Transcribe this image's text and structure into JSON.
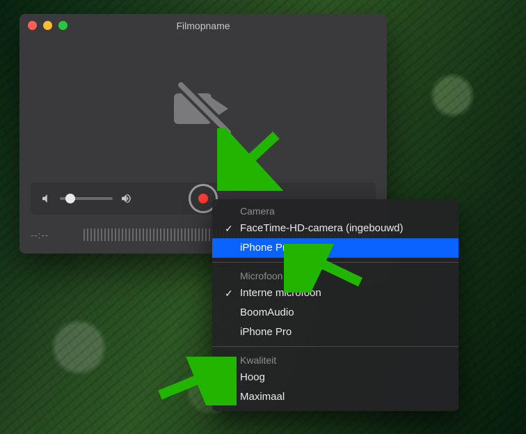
{
  "window": {
    "title": "Filmopname",
    "timecode": "--:--"
  },
  "menu": {
    "sections": [
      {
        "header": "Camera",
        "items": [
          {
            "label": "FaceTime-HD-camera (ingebouwd)",
            "checked": true,
            "selected": false
          },
          {
            "label": "iPhone Pro",
            "checked": false,
            "selected": true
          }
        ]
      },
      {
        "header": "Microfoon",
        "items": [
          {
            "label": "Interne microfoon",
            "checked": true,
            "selected": false
          },
          {
            "label": "BoomAudio",
            "checked": false,
            "selected": false
          },
          {
            "label": "iPhone Pro",
            "checked": false,
            "selected": false
          }
        ]
      },
      {
        "header": "Kwaliteit",
        "items": [
          {
            "label": "Hoog",
            "checked": false,
            "selected": false
          },
          {
            "label": "Maximaal",
            "checked": true,
            "selected": false
          }
        ]
      }
    ]
  },
  "annotations": {
    "arrow_color": "#21b500"
  }
}
